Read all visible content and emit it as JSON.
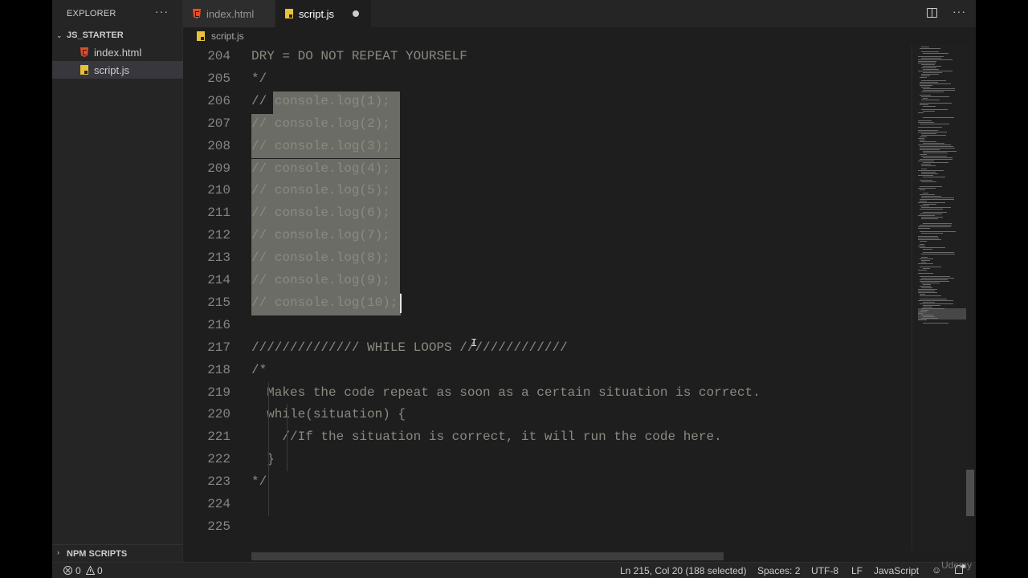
{
  "explorer": {
    "title": "EXPLORER",
    "more": "···",
    "folder": "JS_STARTER",
    "files": [
      {
        "name": "index.html",
        "icon": "html-file-icon"
      },
      {
        "name": "script.js",
        "icon": "js-file-icon"
      }
    ],
    "npm_scripts": "NPM SCRIPTS"
  },
  "tabs": [
    {
      "label": "index.html",
      "icon": "html-file-icon"
    },
    {
      "label": "script.js",
      "icon": "js-file-icon",
      "active": true,
      "dirty": true
    }
  ],
  "breadcrumb": "script.js",
  "editor": {
    "lines": [
      {
        "n": "204",
        "text": "DRY = DO NOT REPEAT YOURSELF"
      },
      {
        "n": "205",
        "text": "*/"
      },
      {
        "n": "206",
        "text": "// console.log(1);"
      },
      {
        "n": "207",
        "text": "// console.log(2);"
      },
      {
        "n": "208",
        "text": "// console.log(3);"
      },
      {
        "n": "209",
        "text": "// console.log(4);"
      },
      {
        "n": "210",
        "text": "// console.log(5);"
      },
      {
        "n": "211",
        "text": "// console.log(6);"
      },
      {
        "n": "212",
        "text": "// console.log(7);"
      },
      {
        "n": "213",
        "text": "// console.log(8);"
      },
      {
        "n": "214",
        "text": "// console.log(9);"
      },
      {
        "n": "215",
        "text": "// console.log(10);"
      },
      {
        "n": "216",
        "text": ""
      },
      {
        "n": "217",
        "text": "////////////// WHILE LOOPS //////////////"
      },
      {
        "n": "218",
        "text": "/*"
      },
      {
        "n": "219",
        "text": "  Makes the code repeat as soon as a certain situation is correct."
      },
      {
        "n": "220",
        "text": "  while(situation) {"
      },
      {
        "n": "221",
        "text": "    //If the situation is correct, it will run the code here."
      },
      {
        "n": "222",
        "text": "  }"
      },
      {
        "n": "223",
        "text": "*/"
      },
      {
        "n": "224",
        "text": ""
      },
      {
        "n": "225",
        "text": ""
      }
    ]
  },
  "status": {
    "errors": "0",
    "warnings": "0",
    "position": "Ln 215, Col 20 (188 selected)",
    "spaces": "Spaces: 2",
    "encoding": "UTF-8",
    "eol": "LF",
    "language": "JavaScript"
  },
  "colors": {
    "accent_html": "#e44d26",
    "accent_js": "#e8c33a",
    "selection": "#6c6c66"
  },
  "watermark": "Udemy"
}
